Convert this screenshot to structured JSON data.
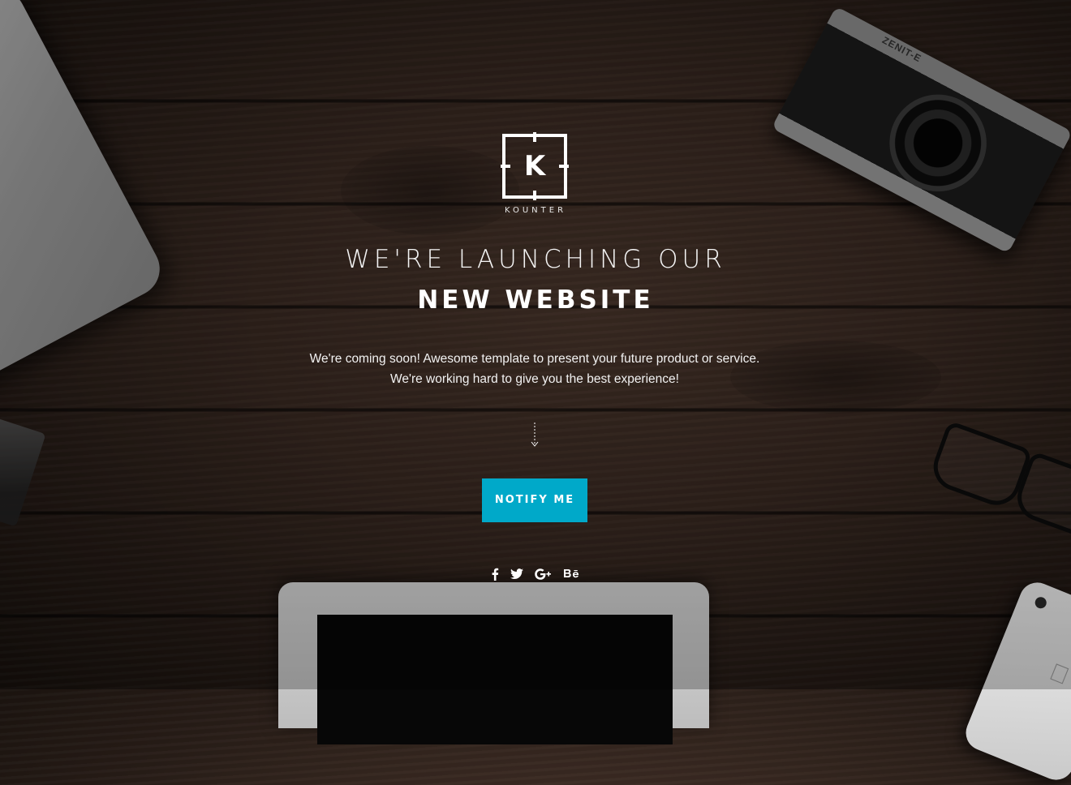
{
  "brand": {
    "logo_letter": "K",
    "logo_text": "KOUNTER"
  },
  "hero": {
    "headline_line1": "WE'RE LAUNCHING OUR",
    "headline_line2": "NEW WEBSITE",
    "description_line1": "We're coming soon! Awesome template to present your future product or service.",
    "description_line2": "We're working hard to give you the best experience!"
  },
  "cta": {
    "notify_label": "NOTIFY ME",
    "button_color": "#00a9c9"
  },
  "social": [
    {
      "name": "facebook-icon",
      "glyph": "f"
    },
    {
      "name": "twitter-icon",
      "glyph": "twitter"
    },
    {
      "name": "google-plus-icon",
      "glyph": "G+"
    },
    {
      "name": "behance-icon",
      "glyph": "Bē"
    }
  ],
  "props": {
    "camera_brand": "ZENIT-E"
  }
}
